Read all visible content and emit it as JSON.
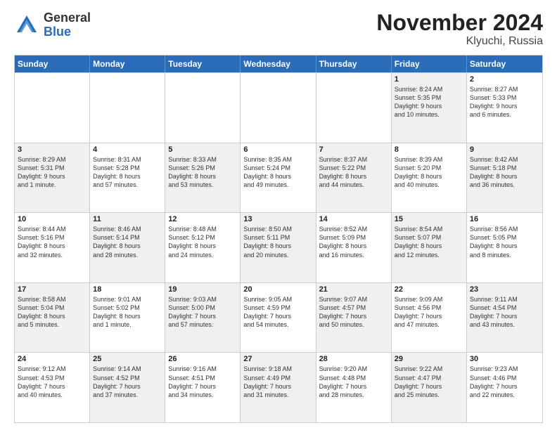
{
  "header": {
    "logo_general": "General",
    "logo_blue": "Blue",
    "month_title": "November 2024",
    "location": "Klyuchi, Russia"
  },
  "weekdays": [
    "Sunday",
    "Monday",
    "Tuesday",
    "Wednesday",
    "Thursday",
    "Friday",
    "Saturday"
  ],
  "rows": [
    [
      {
        "day": "",
        "info": "",
        "shaded": false,
        "empty": true
      },
      {
        "day": "",
        "info": "",
        "shaded": false,
        "empty": true
      },
      {
        "day": "",
        "info": "",
        "shaded": false,
        "empty": true
      },
      {
        "day": "",
        "info": "",
        "shaded": false,
        "empty": true
      },
      {
        "day": "",
        "info": "",
        "shaded": false,
        "empty": true
      },
      {
        "day": "1",
        "info": "Sunrise: 8:24 AM\nSunset: 5:35 PM\nDaylight: 9 hours\nand 10 minutes.",
        "shaded": true
      },
      {
        "day": "2",
        "info": "Sunrise: 8:27 AM\nSunset: 5:33 PM\nDaylight: 9 hours\nand 6 minutes.",
        "shaded": false
      }
    ],
    [
      {
        "day": "3",
        "info": "Sunrise: 8:29 AM\nSunset: 5:31 PM\nDaylight: 9 hours\nand 1 minute.",
        "shaded": true
      },
      {
        "day": "4",
        "info": "Sunrise: 8:31 AM\nSunset: 5:28 PM\nDaylight: 8 hours\nand 57 minutes.",
        "shaded": false
      },
      {
        "day": "5",
        "info": "Sunrise: 8:33 AM\nSunset: 5:26 PM\nDaylight: 8 hours\nand 53 minutes.",
        "shaded": true
      },
      {
        "day": "6",
        "info": "Sunrise: 8:35 AM\nSunset: 5:24 PM\nDaylight: 8 hours\nand 49 minutes.",
        "shaded": false
      },
      {
        "day": "7",
        "info": "Sunrise: 8:37 AM\nSunset: 5:22 PM\nDaylight: 8 hours\nand 44 minutes.",
        "shaded": true
      },
      {
        "day": "8",
        "info": "Sunrise: 8:39 AM\nSunset: 5:20 PM\nDaylight: 8 hours\nand 40 minutes.",
        "shaded": false
      },
      {
        "day": "9",
        "info": "Sunrise: 8:42 AM\nSunset: 5:18 PM\nDaylight: 8 hours\nand 36 minutes.",
        "shaded": true
      }
    ],
    [
      {
        "day": "10",
        "info": "Sunrise: 8:44 AM\nSunset: 5:16 PM\nDaylight: 8 hours\nand 32 minutes.",
        "shaded": false
      },
      {
        "day": "11",
        "info": "Sunrise: 8:46 AM\nSunset: 5:14 PM\nDaylight: 8 hours\nand 28 minutes.",
        "shaded": true
      },
      {
        "day": "12",
        "info": "Sunrise: 8:48 AM\nSunset: 5:12 PM\nDaylight: 8 hours\nand 24 minutes.",
        "shaded": false
      },
      {
        "day": "13",
        "info": "Sunrise: 8:50 AM\nSunset: 5:11 PM\nDaylight: 8 hours\nand 20 minutes.",
        "shaded": true
      },
      {
        "day": "14",
        "info": "Sunrise: 8:52 AM\nSunset: 5:09 PM\nDaylight: 8 hours\nand 16 minutes.",
        "shaded": false
      },
      {
        "day": "15",
        "info": "Sunrise: 8:54 AM\nSunset: 5:07 PM\nDaylight: 8 hours\nand 12 minutes.",
        "shaded": true
      },
      {
        "day": "16",
        "info": "Sunrise: 8:56 AM\nSunset: 5:05 PM\nDaylight: 8 hours\nand 8 minutes.",
        "shaded": false
      }
    ],
    [
      {
        "day": "17",
        "info": "Sunrise: 8:58 AM\nSunset: 5:04 PM\nDaylight: 8 hours\nand 5 minutes.",
        "shaded": true
      },
      {
        "day": "18",
        "info": "Sunrise: 9:01 AM\nSunset: 5:02 PM\nDaylight: 8 hours\nand 1 minute.",
        "shaded": false
      },
      {
        "day": "19",
        "info": "Sunrise: 9:03 AM\nSunset: 5:00 PM\nDaylight: 7 hours\nand 57 minutes.",
        "shaded": true
      },
      {
        "day": "20",
        "info": "Sunrise: 9:05 AM\nSunset: 4:59 PM\nDaylight: 7 hours\nand 54 minutes.",
        "shaded": false
      },
      {
        "day": "21",
        "info": "Sunrise: 9:07 AM\nSunset: 4:57 PM\nDaylight: 7 hours\nand 50 minutes.",
        "shaded": true
      },
      {
        "day": "22",
        "info": "Sunrise: 9:09 AM\nSunset: 4:56 PM\nDaylight: 7 hours\nand 47 minutes.",
        "shaded": false
      },
      {
        "day": "23",
        "info": "Sunrise: 9:11 AM\nSunset: 4:54 PM\nDaylight: 7 hours\nand 43 minutes.",
        "shaded": true
      }
    ],
    [
      {
        "day": "24",
        "info": "Sunrise: 9:12 AM\nSunset: 4:53 PM\nDaylight: 7 hours\nand 40 minutes.",
        "shaded": false
      },
      {
        "day": "25",
        "info": "Sunrise: 9:14 AM\nSunset: 4:52 PM\nDaylight: 7 hours\nand 37 minutes.",
        "shaded": true
      },
      {
        "day": "26",
        "info": "Sunrise: 9:16 AM\nSunset: 4:51 PM\nDaylight: 7 hours\nand 34 minutes.",
        "shaded": false
      },
      {
        "day": "27",
        "info": "Sunrise: 9:18 AM\nSunset: 4:49 PM\nDaylight: 7 hours\nand 31 minutes.",
        "shaded": true
      },
      {
        "day": "28",
        "info": "Sunrise: 9:20 AM\nSunset: 4:48 PM\nDaylight: 7 hours\nand 28 minutes.",
        "shaded": false
      },
      {
        "day": "29",
        "info": "Sunrise: 9:22 AM\nSunset: 4:47 PM\nDaylight: 7 hours\nand 25 minutes.",
        "shaded": true
      },
      {
        "day": "30",
        "info": "Sunrise: 9:23 AM\nSunset: 4:46 PM\nDaylight: 7 hours\nand 22 minutes.",
        "shaded": false
      }
    ]
  ]
}
